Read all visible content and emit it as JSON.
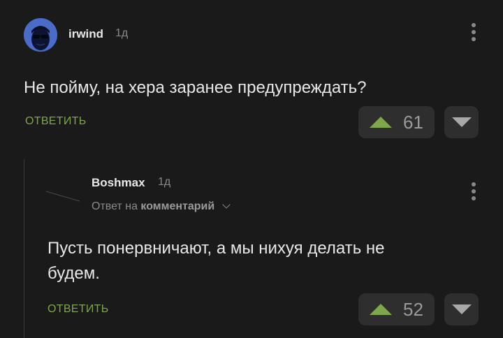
{
  "comment1": {
    "author": "irwind",
    "time": "1д",
    "text": "Не пойму, на хера заранее предупреждать?",
    "reply_label": "ОТВЕТИТЬ",
    "votes": "61"
  },
  "comment2": {
    "author": "Boshmax",
    "time": "1д",
    "reply_to_prefix": "Ответ на",
    "reply_to_target": "комментарий",
    "text_line1": "Пусть понервничают, а мы нихуя делать не",
    "text_line2": "будем.",
    "reply_label": "ОТВЕТИТЬ",
    "votes": "52"
  },
  "colors": {
    "background": "#1a1a1a",
    "accent_green": "#7ea64a",
    "vote_box": "#2e2e2e"
  },
  "icons": [
    "avatar-image",
    "kebab-menu-icon",
    "upvote-icon",
    "downvote-icon",
    "chevron-down-icon"
  ]
}
